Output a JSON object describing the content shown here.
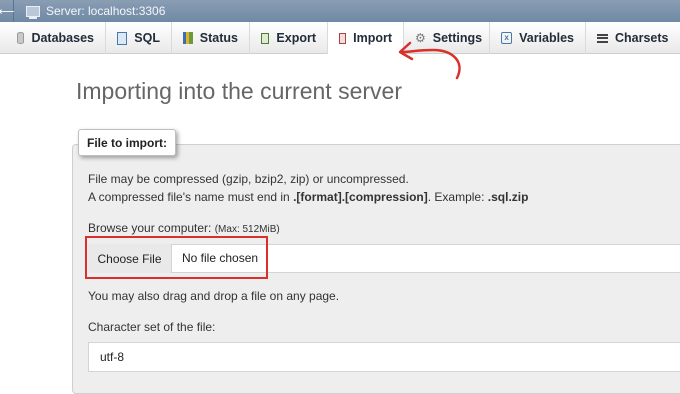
{
  "window": {
    "server_label": "Server: localhost:3306",
    "back_icon": "back-arrow-icon"
  },
  "tabs": [
    {
      "label": "Databases",
      "icon": "database-icon"
    },
    {
      "label": "SQL",
      "icon": "sql-icon"
    },
    {
      "label": "Status",
      "icon": "status-icon"
    },
    {
      "label": "Export",
      "icon": "export-icon"
    },
    {
      "label": "Import",
      "icon": "import-icon",
      "active": true
    },
    {
      "label": "Settings",
      "icon": "settings-icon"
    },
    {
      "label": "Variables",
      "icon": "variables-icon"
    },
    {
      "label": "Charsets",
      "icon": "charsets-icon"
    }
  ],
  "main": {
    "title": "Importing into the current server",
    "fieldset_legend": "File to import:",
    "compression_note": "File may be compressed (gzip, bzip2, zip) or uncompressed.",
    "name_rule_prefix": "A compressed file's name must end in ",
    "name_rule_format": ".[format].[compression]",
    "name_rule_example_prefix": ". Example: ",
    "name_rule_example": ".sql.zip",
    "browse_label": "Browse your computer: ",
    "max_size": "(Max: 512MiB)",
    "choose_file_label": "Choose File",
    "file_status": "No file chosen",
    "drag_drop_note": "You may also drag and drop a file on any page.",
    "charset_label": "Character set of the file:",
    "charset_value": "utf-8"
  },
  "colors": {
    "annotation_red": "#d9302a",
    "header_blue": "#7890a8"
  }
}
